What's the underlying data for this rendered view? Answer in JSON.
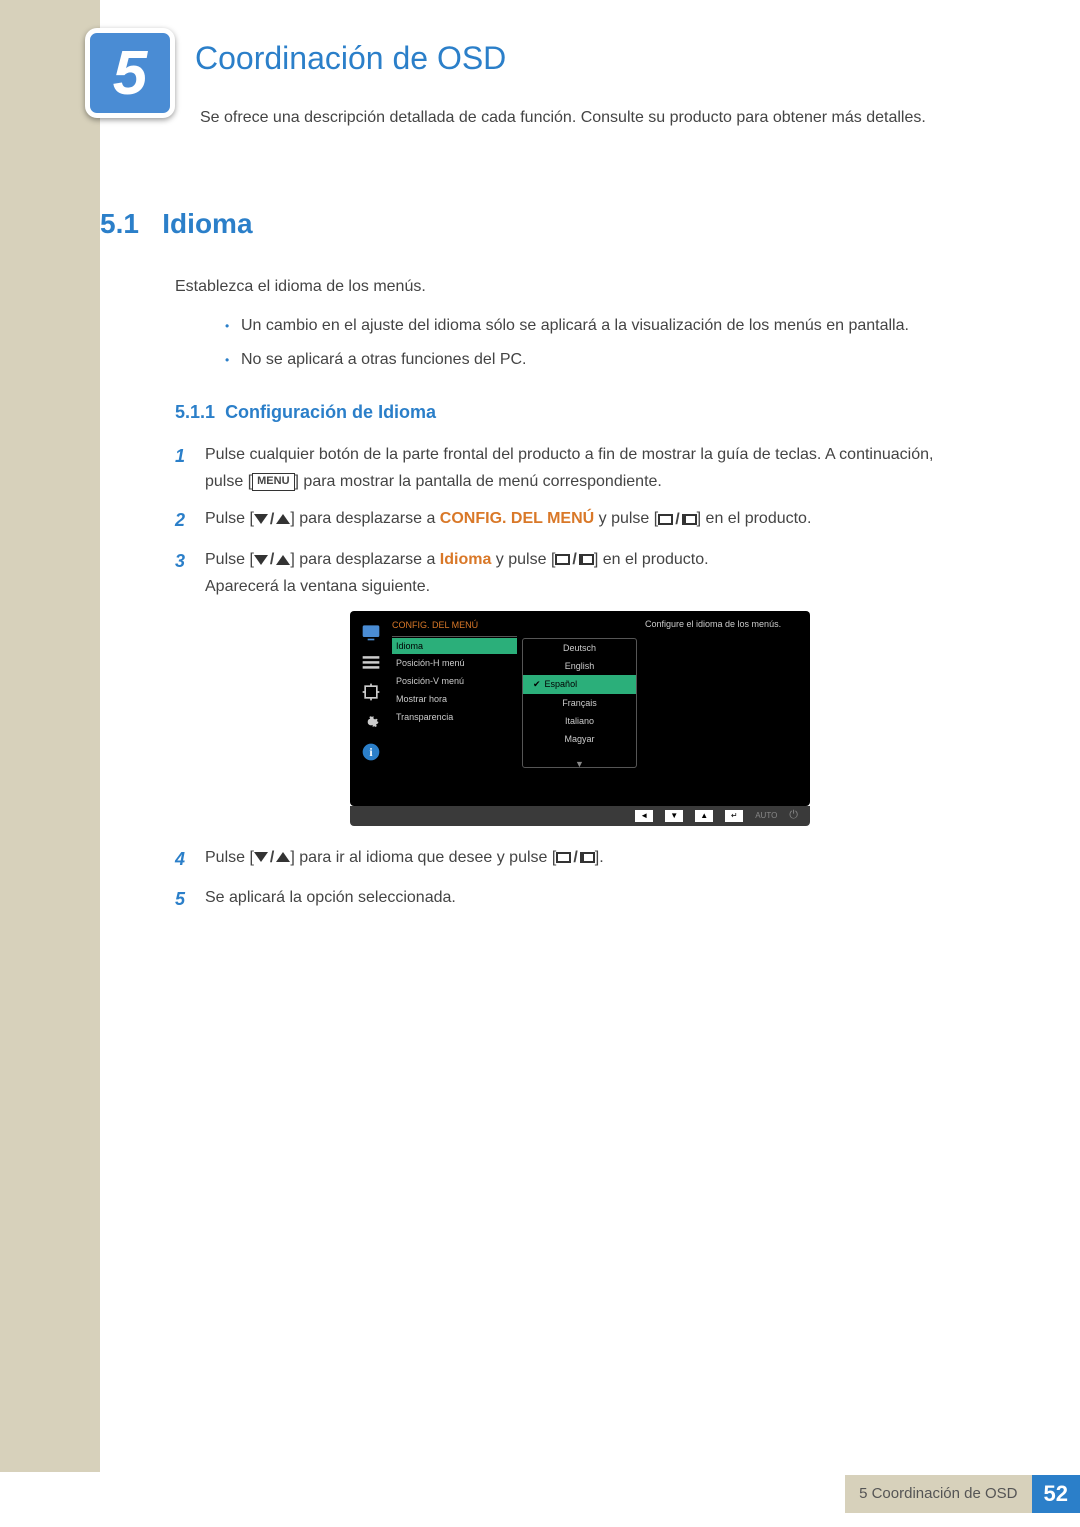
{
  "chapter": {
    "number": "5",
    "title": "Coordinación de OSD"
  },
  "intro": "Se ofrece una descripción detallada de cada función. Consulte su producto para obtener más detalles.",
  "section": {
    "number": "5.1",
    "title": "Idioma",
    "desc": "Establezca el idioma de los menús.",
    "bullets": [
      "Un cambio en el ajuste del idioma sólo se aplicará a la visualización de los menús en pantalla.",
      "No se aplicará a otras funciones del PC."
    ]
  },
  "subsection": {
    "number": "5.1.1",
    "title": "Configuración de Idioma"
  },
  "steps": {
    "s1a": "Pulse cualquier botón de la parte frontal del producto a fin de mostrar la guía de teclas. A continuación, pulse [",
    "menu": "MENU",
    "s1b": "] para mostrar la pantalla de menú correspondiente.",
    "s2a": "Pulse [",
    "s2b": "] para desplazarse a ",
    "s2hl": "CONFIG. DEL MENÚ",
    "s2c": " y pulse [",
    "s2d": "] en el producto.",
    "s3a": "Pulse [",
    "s3b": "] para desplazarse a ",
    "s3hl": "Idioma",
    "s3c": " y pulse [",
    "s3d": "] en el producto.",
    "s3e": "Aparecerá la ventana siguiente.",
    "s4a": "Pulse [",
    "s4b": "] para ir al idioma que desee y pulse [",
    "s4c": "].",
    "s5": "Se aplicará la opción seleccionada."
  },
  "osd": {
    "header": "CONFIG. DEL MENÚ",
    "selected": "Idioma",
    "items": [
      "Posición-H menú",
      "Posición-V menú",
      "Mostrar hora",
      "Transparencia"
    ],
    "langs": [
      "Deutsch",
      "English",
      "Español",
      "Français",
      "Italiano",
      "Magyar"
    ],
    "selectedLang": "Español",
    "help": "Configure el idioma de los menús.",
    "auto": "AUTO"
  },
  "footer": {
    "label": "5 Coordinación de OSD",
    "page": "52"
  }
}
